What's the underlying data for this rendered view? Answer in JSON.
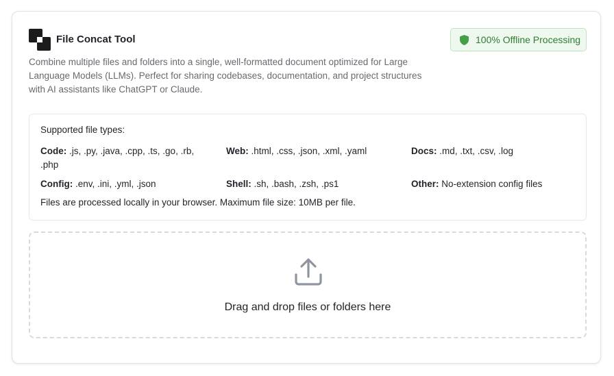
{
  "header": {
    "title": "File Concat Tool",
    "logo_icon": "logo-icon",
    "badge": {
      "label": "100% Offline Processing",
      "icon": "shield-icon",
      "color": "#2e7d32"
    }
  },
  "description": "Combine multiple files and folders into a single, well-formatted document optimized for Large Language Models (LLMs). Perfect for sharing codebases, documentation, and project structures with AI assistants like ChatGPT or Claude.",
  "supported": {
    "heading": "Supported file types:",
    "types": [
      {
        "label": "Code:",
        "value": " .js, .py, .java, .cpp, .ts, .go, .rb, .php"
      },
      {
        "label": "Web:",
        "value": " .html, .css, .json, .xml, .yaml"
      },
      {
        "label": "Docs:",
        "value": " .md, .txt, .csv, .log"
      },
      {
        "label": "Config:",
        "value": " .env, .ini, .yml, .json"
      },
      {
        "label": "Shell:",
        "value": " .sh, .bash, .zsh, .ps1"
      },
      {
        "label": "Other:",
        "value": " No-extension config files"
      }
    ],
    "note": "Files are processed locally in your browser. Maximum file size: 10MB per file."
  },
  "dropzone": {
    "icon": "upload-icon",
    "text": "Drag and drop files or folders here"
  }
}
